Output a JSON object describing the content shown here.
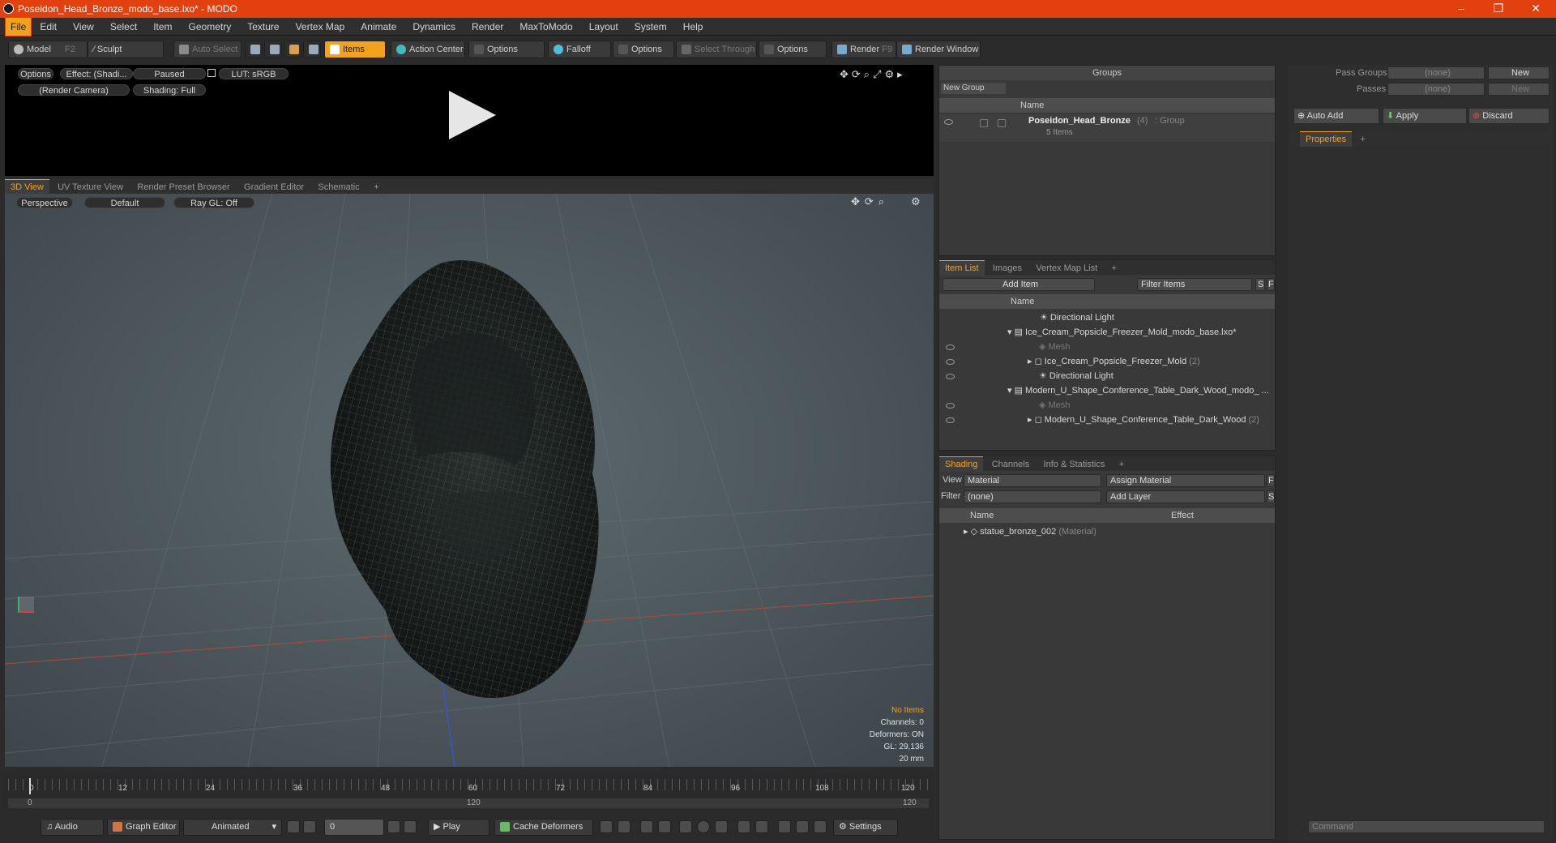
{
  "window": {
    "title": "Poseidon_Head_Bronze_modo_base.lxo* - MODO",
    "minimize": "–",
    "maximize": "❐",
    "close": "✕"
  },
  "menu": [
    "File",
    "Edit",
    "View",
    "Select",
    "Item",
    "Geometry",
    "Texture",
    "Vertex Map",
    "Animate",
    "Dynamics",
    "Render",
    "MaxToModo",
    "Layout",
    "System",
    "Help"
  ],
  "toolbar": {
    "model": "Model",
    "model_key": "F2",
    "sculpt": "Sculpt",
    "auto_select": "Auto Select",
    "items": "Items",
    "action_center": "Action Center",
    "options1": "Options",
    "falloff": "Falloff",
    "options2": "Options",
    "select_through": "Select Through",
    "options3": "Options",
    "render": "Render",
    "render_key": "F9",
    "render_window": "Render Window"
  },
  "preview": {
    "options": "Options",
    "effect": "Effect: (Shadi...",
    "paused": "Paused",
    "lut": "LUT: sRGB",
    "camera": "(Render Camera)",
    "shading": "Shading: Full"
  },
  "viewport_tabs": [
    "3D View",
    "UV Texture View",
    "Render Preset Browser",
    "Gradient Editor",
    "Schematic",
    "+"
  ],
  "viewport": {
    "perspective": "Perspective",
    "default": "Default",
    "raygl": "Ray GL: Off",
    "info": {
      "items": "No Items",
      "channels": "Channels: 0",
      "deformers": "Deformers: ON",
      "gl": "GL: 29,136",
      "scale": "20 mm"
    }
  },
  "timeline": {
    "ticks": [
      "0",
      "12",
      "24",
      "36",
      "48",
      "60",
      "72",
      "84",
      "96",
      "108",
      "120"
    ],
    "bottom_ticks": [
      "0",
      "120",
      "120"
    ]
  },
  "bottom": {
    "audio": "Audio",
    "graph_editor": "Graph Editor",
    "animated": "Animated",
    "frame": "0",
    "play": "Play",
    "cache": "Cache Deformers",
    "settings": "Settings",
    "command": "Command"
  },
  "groups": {
    "title": "Groups",
    "new_group": "New Group",
    "col_name": "Name",
    "group_name": "Poseidon_Head_Bronze",
    "group_count": "(4)",
    "group_type": ": Group",
    "group_items": "5 Items"
  },
  "item_list": {
    "tabs": [
      "Item List",
      "Images",
      "Vertex Map List",
      "+"
    ],
    "add_item": "Add Item",
    "filter": "Filter Items",
    "s": "S",
    "f": "F",
    "col_name": "Name",
    "rows": [
      {
        "label": "Directional Light",
        "extra": ""
      },
      {
        "label": "Ice_Cream_Popsicle_Freezer_Mold_modo_base.lxo*",
        "extra": ""
      },
      {
        "label": "Mesh",
        "extra": ""
      },
      {
        "label": "Ice_Cream_Popsicle_Freezer_Mold",
        "extra": "(2)"
      },
      {
        "label": "Directional Light",
        "extra": ""
      },
      {
        "label": "Modern_U_Shape_Conference_Table_Dark_Wood_modo_ ...",
        "extra": ""
      },
      {
        "label": "Mesh",
        "extra": ""
      },
      {
        "label": "Modern_U_Shape_Conference_Table_Dark_Wood",
        "extra": "(2)"
      }
    ]
  },
  "shading": {
    "tabs": [
      "Shading",
      "Channels",
      "Info & Statistics",
      "+"
    ],
    "view_label": "View",
    "view_value": "Material",
    "assign": "Assign Material",
    "f": "F",
    "filter_label": "Filter",
    "filter_value": "(none)",
    "add_layer": "Add Layer",
    "s": "S",
    "col_name": "Name",
    "col_effect": "Effect",
    "material": "statue_bronze_002",
    "material_type": "(Material)"
  },
  "right": {
    "pass_groups": "Pass Groups",
    "passes": "Passes",
    "none1": "(none)",
    "none2": "(none)",
    "new1": "New",
    "new2": "New",
    "auto_add": "Auto Add",
    "apply": "Apply",
    "discard": "Discard",
    "properties": "Properties",
    "plus": "+"
  }
}
